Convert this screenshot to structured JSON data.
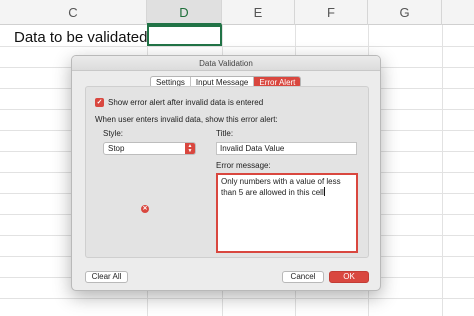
{
  "sheet": {
    "columns": [
      "C",
      "D",
      "E",
      "F",
      "G"
    ],
    "active_column": "D",
    "cell_label": "Data to be validated -->"
  },
  "dialog": {
    "title": "Data Validation",
    "tabs": [
      {
        "label": "Settings",
        "selected": false
      },
      {
        "label": "Input Message",
        "selected": false
      },
      {
        "label": "Error Alert",
        "selected": true
      }
    ],
    "show_alert_checkbox": {
      "label": "Show error alert after invalid data is entered",
      "checked": true
    },
    "instruction": "When user enters invalid data, show this error alert:",
    "style_label": "Style:",
    "style_value": "Stop",
    "title_label": "Title:",
    "title_value": "Invalid Data Value",
    "message_label": "Error message:",
    "message_value": "Only numbers with a value of less than 5 are allowed in this cell",
    "buttons": {
      "clear_all": "Clear All",
      "cancel": "Cancel",
      "ok": "OK"
    }
  },
  "colors": {
    "accent": "#d9473f",
    "excel_green": "#217346"
  },
  "icons": {
    "checkbox": "check-icon",
    "select_arrows": "chevron-up-down-icon",
    "error_style": "stop-circle-icon"
  }
}
